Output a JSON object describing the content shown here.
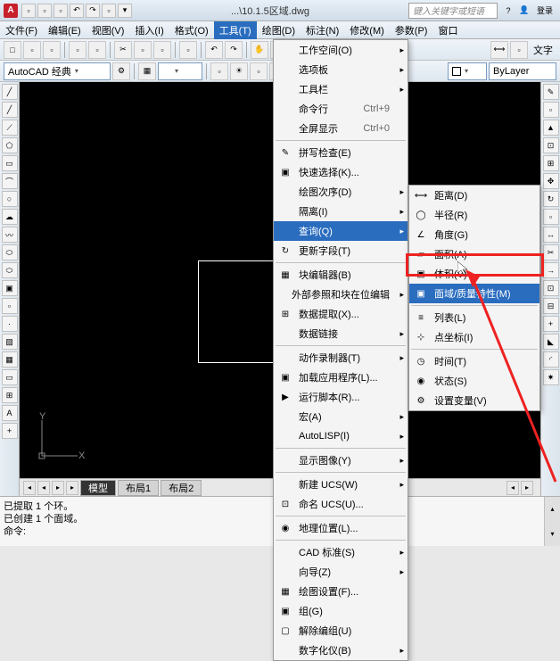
{
  "title_bar": {
    "app": "A",
    "doc_title": "...\\10.1.5区域.dwg",
    "search_placeholder": "键入关键字或短语",
    "login": "登录"
  },
  "menu_bar": {
    "items": [
      {
        "label": "文件(F)"
      },
      {
        "label": "编辑(E)"
      },
      {
        "label": "视图(V)"
      },
      {
        "label": "插入(I)"
      },
      {
        "label": "格式(O)"
      },
      {
        "label": "工具(T)",
        "active": true
      },
      {
        "label": "绘图(D)"
      },
      {
        "label": "标注(N)"
      },
      {
        "label": "修改(M)"
      },
      {
        "label": "参数(P)"
      },
      {
        "label": "窗口"
      }
    ]
  },
  "toolbar2": {
    "workspace_label": "AutoCAD 经典",
    "bylayer": "ByLayer",
    "text_label": "文字"
  },
  "tools_menu": [
    {
      "label": "工作空间(O)",
      "sub": true
    },
    {
      "label": "选项板",
      "sub": true
    },
    {
      "label": "工具栏",
      "sub": true
    },
    {
      "label": "命令行",
      "short": "Ctrl+9"
    },
    {
      "label": "全屏显示",
      "short": "Ctrl+0"
    },
    {
      "sep": true
    },
    {
      "label": "拼写检查(E)",
      "icon": "✎"
    },
    {
      "label": "快速选择(K)...",
      "icon": "▣"
    },
    {
      "label": "绘图次序(D)",
      "sub": true
    },
    {
      "label": "隔离(I)",
      "sub": true
    },
    {
      "label": "查询(Q)",
      "sub": true,
      "hl": true
    },
    {
      "label": "更新字段(T)",
      "icon": "↻"
    },
    {
      "sep": true
    },
    {
      "label": "块编辑器(B)",
      "icon": "▦"
    },
    {
      "label": "外部参照和块在位编辑",
      "sub": true
    },
    {
      "label": "数据提取(X)...",
      "icon": "⊞"
    },
    {
      "label": "数据链接",
      "sub": true
    },
    {
      "sep": true
    },
    {
      "label": "动作录制器(T)",
      "sub": true
    },
    {
      "label": "加载应用程序(L)...",
      "icon": "▣"
    },
    {
      "label": "运行脚本(R)...",
      "icon": "▶"
    },
    {
      "label": "宏(A)",
      "sub": true
    },
    {
      "label": "AutoLISP(I)",
      "sub": true
    },
    {
      "sep": true
    },
    {
      "label": "显示图像(Y)",
      "sub": true
    },
    {
      "sep": true
    },
    {
      "label": "新建 UCS(W)",
      "sub": true
    },
    {
      "label": "命名 UCS(U)...",
      "icon": "⊡"
    },
    {
      "sep": true
    },
    {
      "label": "地理位置(L)...",
      "icon": "◉"
    },
    {
      "sep": true
    },
    {
      "label": "CAD 标准(S)",
      "sub": true
    },
    {
      "label": "向导(Z)",
      "sub": true
    },
    {
      "label": "绘图设置(F)...",
      "icon": "▦"
    },
    {
      "label": "组(G)",
      "icon": "▣"
    },
    {
      "label": "解除编组(U)",
      "icon": "▢"
    },
    {
      "label": "数字化仪(B)",
      "sub": true
    }
  ],
  "query_menu": [
    {
      "label": "距离(D)",
      "icon": "⟷"
    },
    {
      "label": "半径(R)",
      "icon": "◯"
    },
    {
      "label": "角度(G)",
      "icon": "∠"
    },
    {
      "label": "面积(A)",
      "icon": "▱"
    },
    {
      "label": "体积(V)",
      "icon": "▣"
    },
    {
      "label": "面域/质量特性(M)",
      "icon": "▣",
      "hl": true
    },
    {
      "sep": true
    },
    {
      "label": "列表(L)",
      "icon": "≡"
    },
    {
      "label": "点坐标(I)",
      "icon": "⊹"
    },
    {
      "sep": true
    },
    {
      "label": "时间(T)",
      "icon": "◷"
    },
    {
      "label": "状态(S)",
      "icon": "◉"
    },
    {
      "label": "设置变量(V)",
      "icon": "⚙"
    }
  ],
  "tabs": {
    "nav": [
      "◂",
      "◂",
      "▸",
      "▸"
    ],
    "items": [
      "模型",
      "布局1",
      "布局2"
    ]
  },
  "cmd": {
    "line1": "已提取 1 个环。",
    "line2": "已创建 1 个面域。",
    "prompt": "命令:"
  },
  "ucs": {
    "y": "Y",
    "x": "X"
  }
}
